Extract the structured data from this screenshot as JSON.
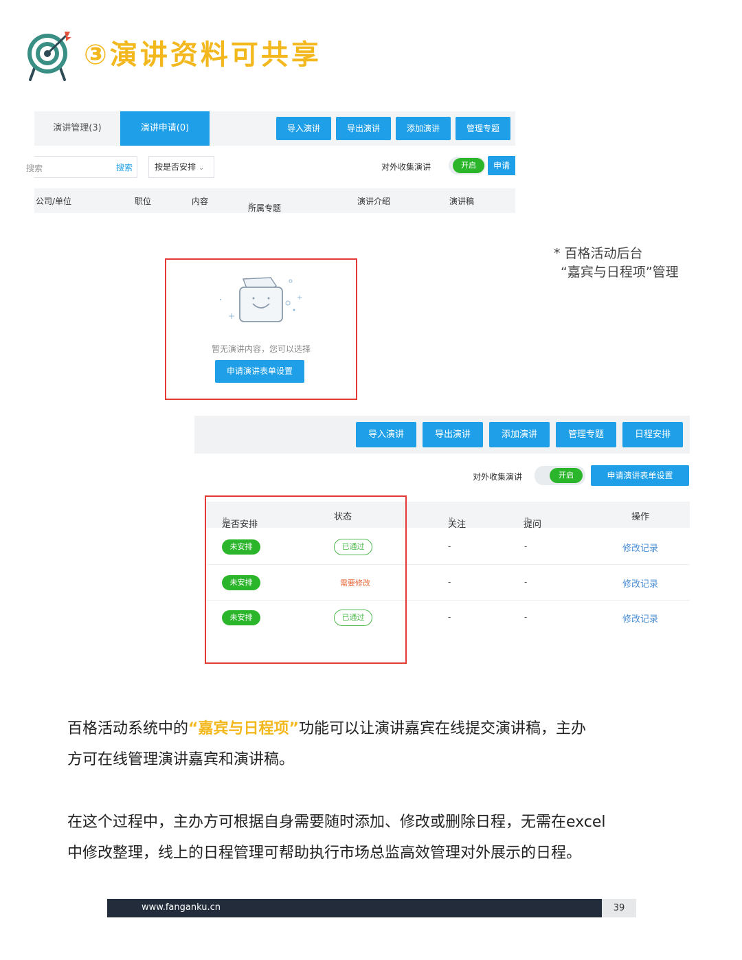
{
  "title": "③演讲资料可共享",
  "shot1": {
    "tabs": [
      "演讲管理(3)",
      "演讲申请(0)"
    ],
    "buttons": [
      "导入演讲",
      "导出演讲",
      "添加演讲",
      "管理专题"
    ],
    "search_placeholder": "搜索",
    "search_button": "搜索",
    "sort_select": "按是否安排",
    "collect_label": "对外收集演讲",
    "toggle_label": "开启",
    "apply_button_partial": "申请",
    "columns": [
      "公司/单位",
      "职位",
      "内容",
      "所属专题",
      "演讲介绍",
      "演讲稿"
    ]
  },
  "empty_state": {
    "text": "暂无演讲内容，您可以选择",
    "button": "申请演讲表单设置"
  },
  "caption": {
    "line1": "* 百格活动后台",
    "line2": "“嘉宾与日程项”管理"
  },
  "shot2": {
    "buttons": [
      "导入演讲",
      "导出演讲",
      "添加演讲",
      "管理专题",
      "日程安排"
    ],
    "collect_label": "对外收集演讲",
    "toggle_label": "开启",
    "form_button": "申请演讲表单设置",
    "columns": [
      "是否安排",
      "状态",
      "关注",
      "提问",
      "操作"
    ],
    "rows": [
      {
        "arranged": "未安排",
        "status": "已通过",
        "status_type": "pass",
        "follow": "-",
        "question": "-",
        "action": "修改记录"
      },
      {
        "arranged": "未安排",
        "status": "需要修改",
        "status_type": "revise",
        "follow": "-",
        "question": "-",
        "action": "修改记录"
      },
      {
        "arranged": "未安排",
        "status": "已通过",
        "status_type": "pass",
        "follow": "-",
        "question": "-",
        "action": "修改记录"
      }
    ]
  },
  "para1": {
    "before": "百格活动系统中的",
    "highlight": "“嘉宾与日程项”",
    "after_line1": "功能可以让演讲嘉宾在线提交演讲稿，主办",
    "line2": "方可在线管理演讲嘉宾和演讲稿。"
  },
  "para2": {
    "line1": "在这个过程中，主办方可根据自身需要随时添加、修改或删除日程，无需在excel",
    "line2": "中修改整理，线上的日程管理可帮助执行市场总监高效管理对外展示的日程。"
  },
  "footer": {
    "url": "www.fanganku.cn",
    "page": "39"
  },
  "colors": {
    "accent_yellow": "#f3b81d",
    "primary_blue": "#1e9fe8",
    "green": "#2bb52b",
    "frame_red": "#e53935",
    "footer_dark": "#222c3b"
  }
}
